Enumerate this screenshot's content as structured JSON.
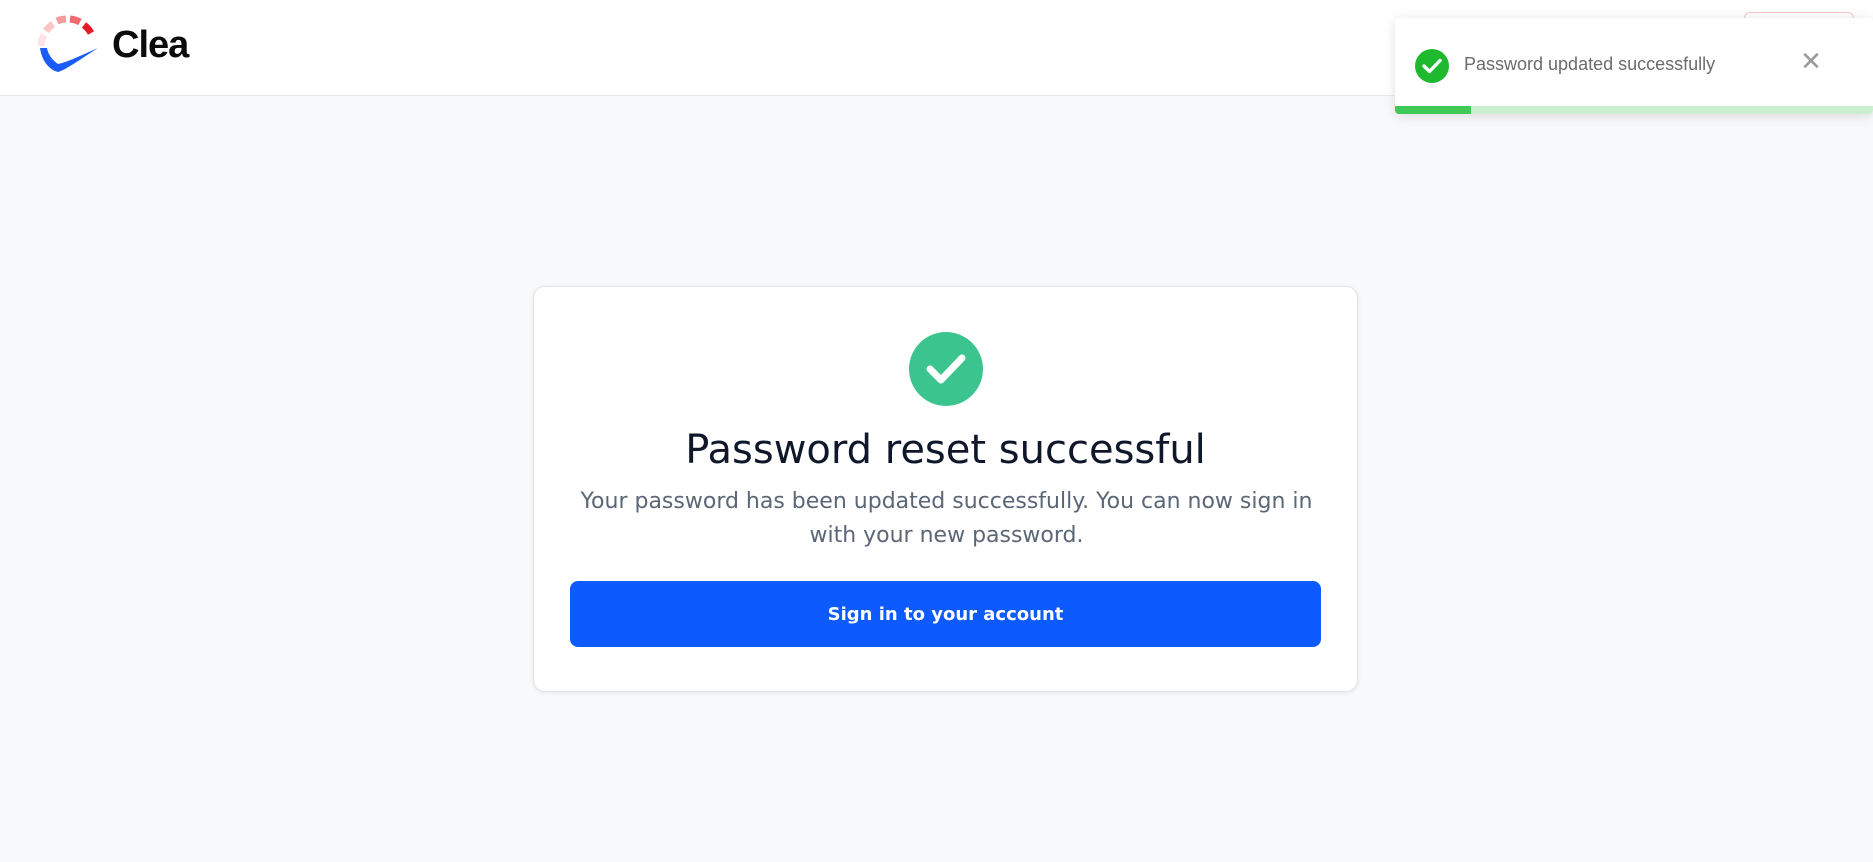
{
  "header": {
    "logo_text": "Clea"
  },
  "card": {
    "title": "Password reset successful",
    "description": "Your password has been updated successfully. You can now sign in with your new password.",
    "button_label": "Sign in to your account"
  },
  "toast": {
    "message": "Password updated successfully",
    "close_glyph": "✕",
    "progress_fraction": 0.16
  },
  "colors": {
    "primary": "#0d5bff",
    "success": "#3cc48f",
    "toast_success": "#1fb92f",
    "logo_blue": "#1a5cf5",
    "logo_red": "#e51b23"
  },
  "icons": {
    "logo": "clea-logo-icon",
    "success": "check-circle-icon",
    "toast_success": "check-icon",
    "close": "close-icon"
  }
}
